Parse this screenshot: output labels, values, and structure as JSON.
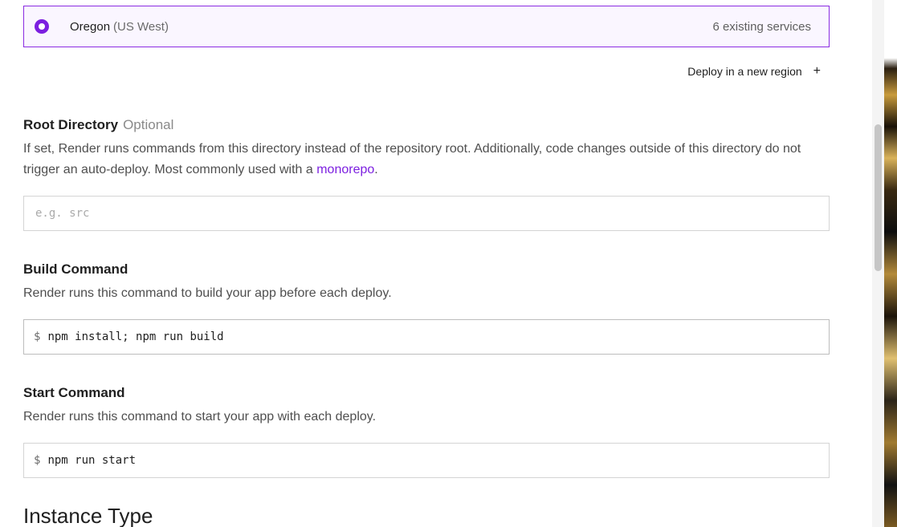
{
  "region": {
    "name": "Oregon",
    "sub": "(US West)",
    "services": "6 existing services",
    "deploy_new": "Deploy in a new region",
    "plus_icon": "+"
  },
  "root_directory": {
    "title": "Root Directory",
    "optional": "Optional",
    "desc_before": "If set, Render runs commands from this directory instead of the repository root. Additionally, code changes outside of this directory do not trigger an auto-deploy. Most commonly used with a ",
    "link": "monorepo",
    "desc_after": ".",
    "placeholder": "e.g. src",
    "value": ""
  },
  "build_command": {
    "title": "Build Command",
    "desc": "Render runs this command to build your app before each deploy.",
    "prefix": "$",
    "value": "npm install; npm run build"
  },
  "start_command": {
    "title": "Start Command",
    "desc": "Render runs this command to start your app with each deploy.",
    "prefix": "$",
    "value": "npm run start"
  },
  "instance_type": {
    "title": "Instance Type"
  },
  "colors": {
    "accent": "#7c1fe0",
    "border_selected": "#8a2be2"
  }
}
